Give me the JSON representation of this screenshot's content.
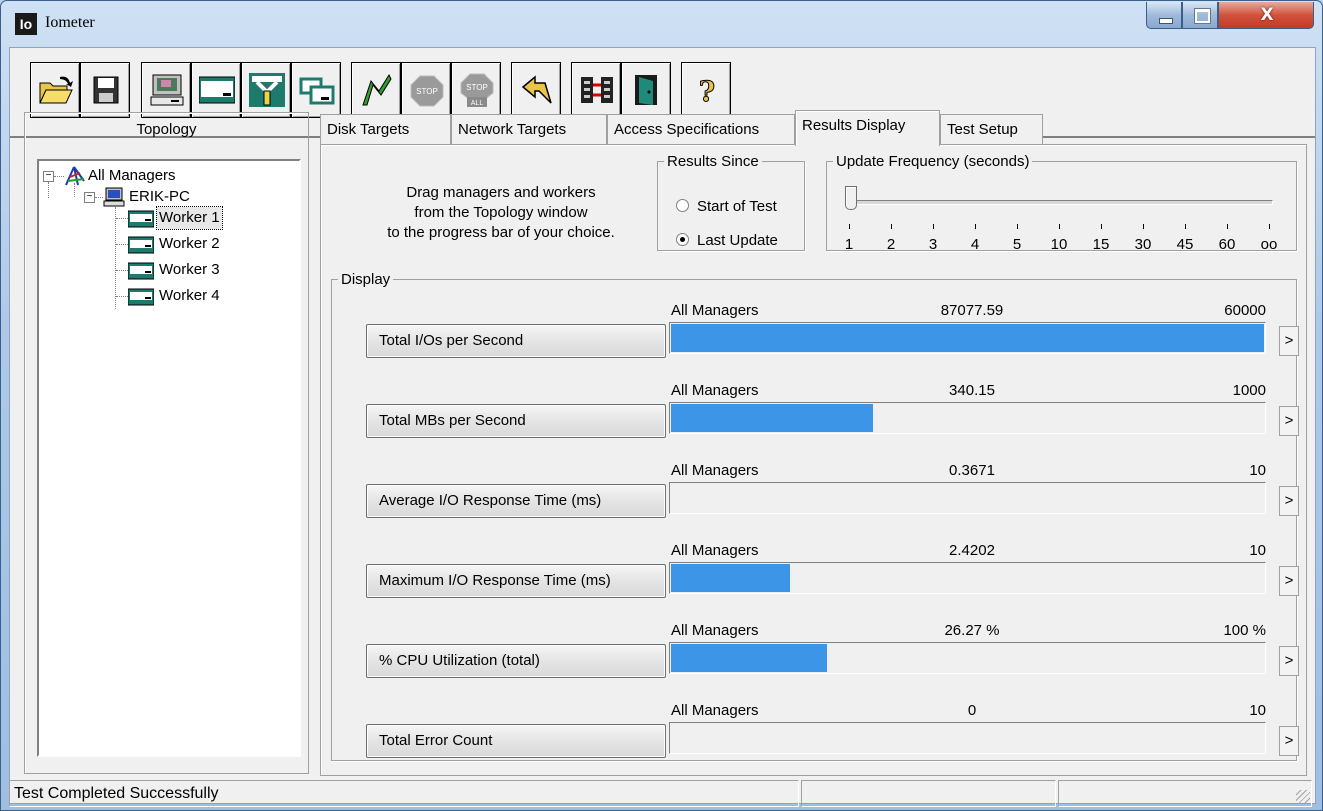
{
  "window": {
    "title": "Iometer",
    "app_icon_text": "Io"
  },
  "toolbar": {
    "buttons": [
      {
        "name": "open-icon"
      },
      {
        "name": "save-icon"
      },
      {
        "name": "new-manager-icon"
      },
      {
        "name": "new-disk-worker-icon"
      },
      {
        "name": "new-network-worker-icon"
      },
      {
        "name": "duplicate-worker-icon"
      },
      {
        "name": "start-test-icon"
      },
      {
        "name": "stop-icon"
      },
      {
        "name": "stop-all-icon"
      },
      {
        "name": "reset-workers-icon"
      },
      {
        "name": "disconnect-icon"
      },
      {
        "name": "exit-icon"
      },
      {
        "name": "help-icon"
      }
    ],
    "stop_text": "STOP",
    "stop_all_text": "STOP",
    "stop_all_sub": "ALL",
    "help_text": "?"
  },
  "topology": {
    "title": "Topology",
    "root": "All Managers",
    "manager": "ERIK-PC",
    "workers": [
      "Worker 1",
      "Worker 2",
      "Worker 3",
      "Worker 4"
    ]
  },
  "tabs": [
    "Disk Targets",
    "Network Targets",
    "Access Specifications",
    "Results Display",
    "Test Setup"
  ],
  "active_tab": "Results Display",
  "hint_lines": [
    "Drag managers and workers",
    "from the Topology window",
    "to the progress bar of your choice."
  ],
  "results_since": {
    "legend": "Results Since",
    "options": [
      "Start of Test",
      "Last Update"
    ],
    "selected": "Last Update"
  },
  "update_frequency": {
    "legend": "Update Frequency (seconds)",
    "ticks": [
      "1",
      "2",
      "3",
      "4",
      "5",
      "10",
      "15",
      "30",
      "45",
      "60",
      "oo"
    ],
    "value": "1"
  },
  "display": {
    "legend": "Display",
    "rows": [
      {
        "button": "Total I/Os per Second",
        "source": "All Managers",
        "value": "87077.59",
        "max": "60000",
        "fill": 1.0
      },
      {
        "button": "Total MBs per Second",
        "source": "All Managers",
        "value": "340.15",
        "max": "1000",
        "fill": 0.3402
      },
      {
        "button": "Average I/O Response Time (ms)",
        "source": "All Managers",
        "value": "0.3671",
        "max": "10",
        "fill": 0.0
      },
      {
        "button": "Maximum I/O Response Time (ms)",
        "source": "All Managers",
        "value": "2.4202",
        "max": "10",
        "fill": 0.2
      },
      {
        "button": "% CPU Utilization (total)",
        "source": "All Managers",
        "value": "26.27 %",
        "max": "100 %",
        "fill": 0.2627
      },
      {
        "button": "Total Error Count",
        "source": "All Managers",
        "value": "0",
        "max": "10",
        "fill": 0.0
      }
    ],
    "arrow": ">"
  },
  "status_bar": {
    "text": "Test Completed Successfully"
  },
  "colors": {
    "bar_fill": "#3d95e8",
    "close_button": "#c53a22"
  }
}
